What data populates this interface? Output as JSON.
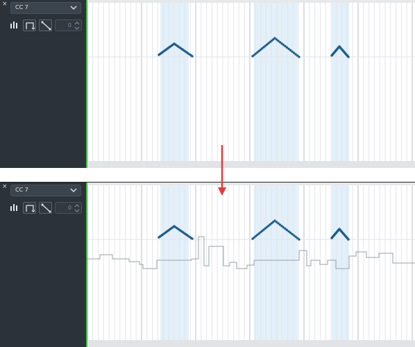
{
  "editor": {
    "close_glyph": "×",
    "controller_label": "CC 7",
    "value": "0"
  },
  "colors": {
    "sidebar": "#2b323a",
    "highlight": "#e3f0fa",
    "curve": "#1f5e8a",
    "arrow": "#e03c3c",
    "green_line": "#3fbf3f"
  },
  "icons": {
    "close": "close-icon",
    "dropdown": "chevron-down-icon",
    "draw": "bar-chart-icon",
    "select": "select-range-icon",
    "line": "line-tool-icon",
    "stepper": "stepper-arrows-icon",
    "arrow": "down-arrow-icon"
  }
}
